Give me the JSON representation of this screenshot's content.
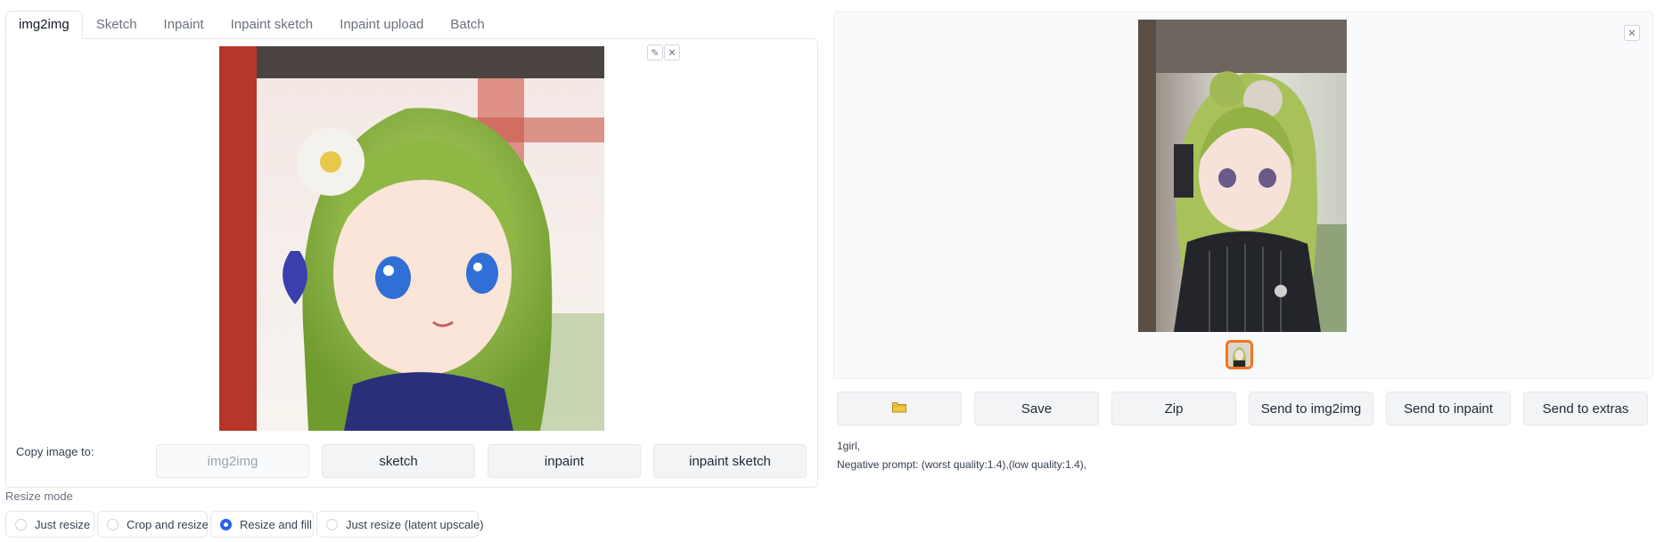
{
  "tabs": [
    "img2img",
    "Sketch",
    "Inpaint",
    "Inpaint sketch",
    "Inpaint upload",
    "Batch"
  ],
  "input_image": {
    "edit_icon": "pencil-icon",
    "close_icon": "close-icon",
    "edit_glyph": "✎",
    "close_glyph": "✕"
  },
  "copy_image": {
    "label": "Copy image to:",
    "buttons": [
      "img2img",
      "sketch",
      "inpaint",
      "inpaint sketch"
    ]
  },
  "resize_mode": {
    "label": "Resize mode",
    "options": [
      "Just resize",
      "Crop and resize",
      "Resize and fill",
      "Just resize (latent upscale)"
    ],
    "selected": "Resize and fill"
  },
  "output": {
    "close_glyph": "✕",
    "buttons": {
      "folder_icon": "folder-icon",
      "save": "Save",
      "zip": "Zip",
      "send_img2img": "Send to img2img",
      "send_inpaint": "Send to inpaint",
      "send_extras": "Send to extras"
    },
    "info_prompt": "1girl,",
    "info_negative": "Negative prompt: (worst quality:1.4),(low quality:1.4),"
  },
  "colors": {
    "accent": "#2563eb",
    "thumb_border": "#f97316",
    "button_bg": "#f3f4f6"
  }
}
